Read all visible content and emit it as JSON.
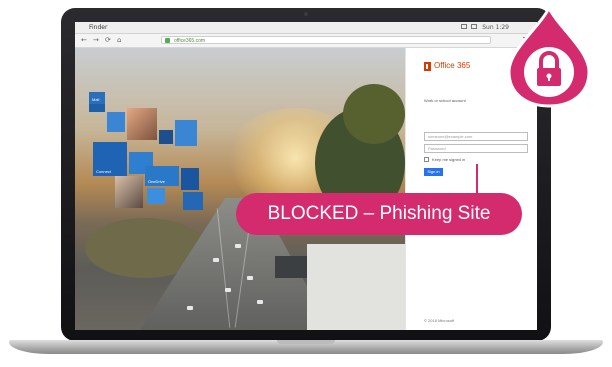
{
  "menubar": {
    "app_name": "Finder",
    "status_text": "Sun 1:29"
  },
  "browser": {
    "nav": {
      "back": "←",
      "forward": "→",
      "reload": "⟳",
      "home": "⌂"
    },
    "url": "office365.com"
  },
  "hero": {
    "tiles": [
      {
        "label": "Mail"
      },
      {
        "label": "Connect"
      },
      {
        "label": "OneDrive"
      }
    ]
  },
  "login": {
    "brand": "Office 365",
    "prompt": "Work or school account",
    "email_placeholder": "someone@example.com",
    "password_placeholder": "Password",
    "keep_signed_in": "Keep me signed in",
    "signin_label": "Sign in",
    "footer": "© 2016 Microsoft"
  },
  "overlay": {
    "blocked_text": "BLOCKED – Phishing Site",
    "accent_color": "#d42a6e",
    "badge_icon": "lock-icon"
  }
}
